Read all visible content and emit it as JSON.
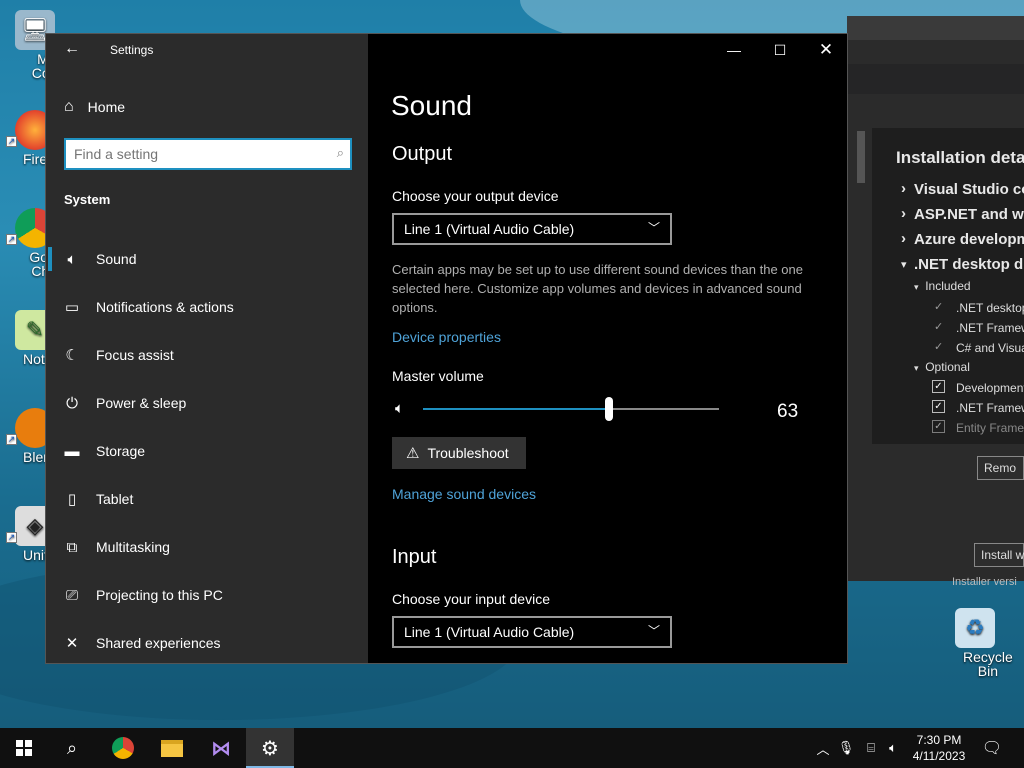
{
  "desktop": {
    "icons": [
      {
        "label": "My Com",
        "icon": "computer-icon"
      },
      {
        "label": "Firef",
        "icon": "firefox-icon"
      },
      {
        "label": "Goog Chro",
        "icon": "chrome-icon"
      },
      {
        "label": "Notepa",
        "icon": "notepad-icon"
      },
      {
        "label": "Blende",
        "icon": "blender-icon"
      },
      {
        "label": "Unity",
        "icon": "unity-icon"
      },
      {
        "label": "Recycle Bin",
        "icon": "recycle-bin-icon"
      }
    ]
  },
  "vs_installer": {
    "title": "Installation deta",
    "workloads": [
      "Visual Studio co",
      "ASP.NET and we",
      "Azure developm",
      ".NET desktop d"
    ],
    "included_label": "Included",
    "included_items": [
      ".NET desktop",
      ".NET Framew",
      "C# and Visua"
    ],
    "optional_label": "Optional",
    "optional_items": [
      "Development",
      ".NET Framew",
      "Entity Framew"
    ],
    "remove_button": "Remo",
    "install_button": "Install wh",
    "footer_text": "Installer versi"
  },
  "settings": {
    "app_title": "Settings",
    "home_label": "Home",
    "search_placeholder": "Find a setting",
    "section_label": "System",
    "nav_items": [
      {
        "label": "Sound",
        "icon": "speaker-icon",
        "active": true
      },
      {
        "label": "Notifications & actions",
        "icon": "notifications-icon",
        "active": false
      },
      {
        "label": "Focus assist",
        "icon": "moon-icon",
        "active": false
      },
      {
        "label": "Power & sleep",
        "icon": "power-icon",
        "active": false
      },
      {
        "label": "Storage",
        "icon": "storage-icon",
        "active": false
      },
      {
        "label": "Tablet",
        "icon": "tablet-icon",
        "active": false
      },
      {
        "label": "Multitasking",
        "icon": "multitasking-icon",
        "active": false
      },
      {
        "label": "Projecting to this PC",
        "icon": "projecting-icon",
        "active": false
      },
      {
        "label": "Shared experiences",
        "icon": "shared-experiences-icon",
        "active": false
      }
    ],
    "page_title": "Sound",
    "output": {
      "heading": "Output",
      "choose_label": "Choose your output device",
      "device": "Line 1 (Virtual Audio Cable)",
      "description": "Certain apps may be set up to use different sound devices than the one selected here. Customize app volumes and devices in advanced sound options.",
      "device_properties_link": "Device properties",
      "master_volume_label": "Master volume",
      "volume": 63,
      "volume_text": "63",
      "troubleshoot_label": "Troubleshoot",
      "manage_link": "Manage sound devices"
    },
    "input": {
      "heading": "Input",
      "choose_label": "Choose your input device",
      "device": "Line 1 (Virtual Audio Cable)"
    }
  },
  "taskbar": {
    "apps": [
      "start-icon",
      "search-icon",
      "chrome-icon",
      "file-explorer-icon",
      "visual-studio-icon",
      "settings-icon"
    ],
    "time": "7:30 PM",
    "date": "4/11/2023"
  },
  "colors": {
    "accent": "#1e90c0",
    "link": "#4fa3d8",
    "sidebar_bg": "#2b2b2b",
    "content_bg": "#000000"
  }
}
